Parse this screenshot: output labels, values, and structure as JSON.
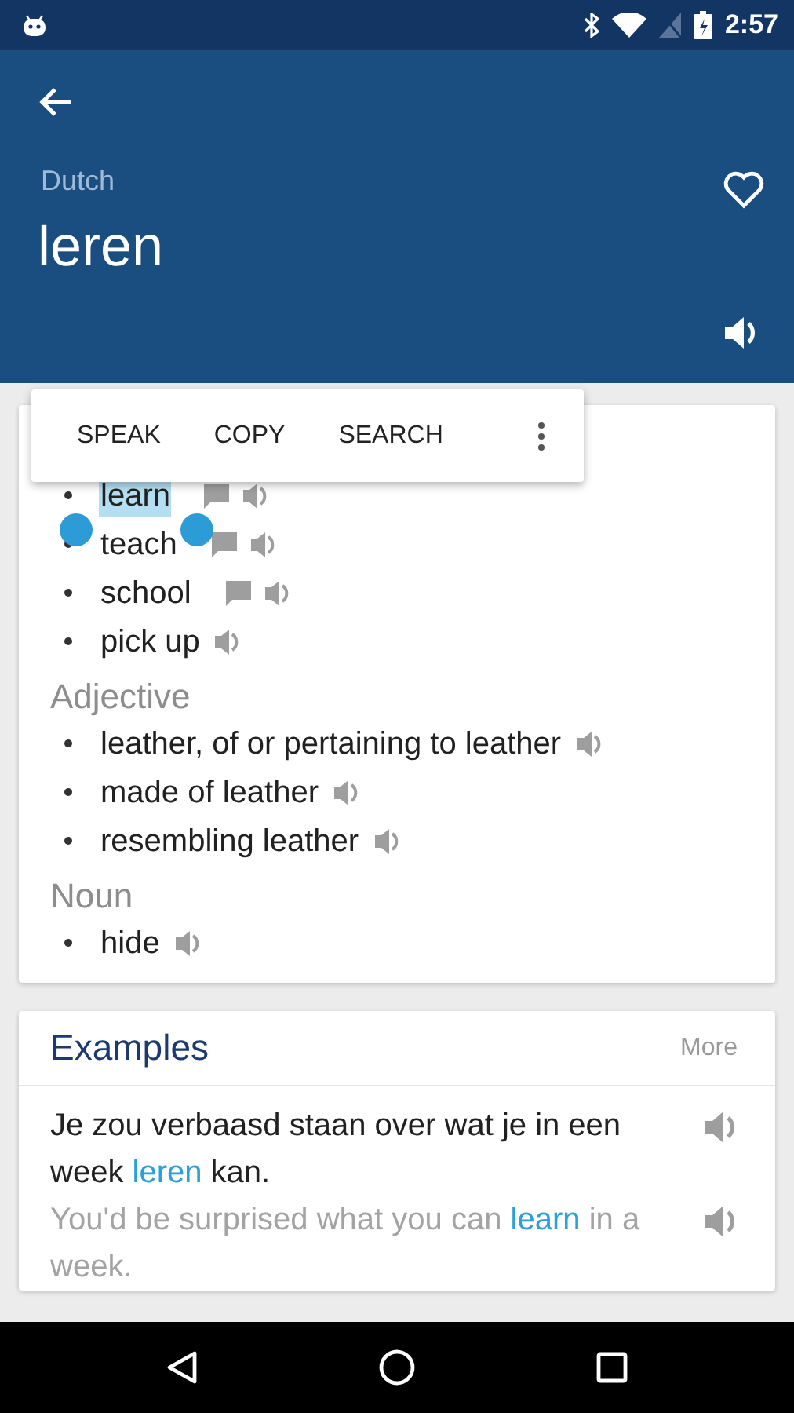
{
  "status_bar": {
    "time": "2:57"
  },
  "app_bar": {
    "language": "Dutch",
    "word": "leren",
    "favorite": false
  },
  "selection_menu": {
    "items": [
      "SPEAK",
      "COPY",
      "SEARCH"
    ]
  },
  "sections": [
    {
      "entries": [
        {
          "text": "learn",
          "selected": true,
          "note": true
        },
        {
          "text": "teach",
          "selected": false,
          "note": true
        },
        {
          "text": "school",
          "selected": false,
          "note": true
        },
        {
          "text": "pick up",
          "selected": false,
          "note": false
        }
      ]
    },
    {
      "heading": "Adjective",
      "entries": [
        {
          "text": "leather, of or pertaining to leather",
          "selected": false,
          "note": false
        },
        {
          "text": "made of leather",
          "selected": false,
          "note": false
        },
        {
          "text": "resembling leather",
          "selected": false,
          "note": false
        }
      ]
    },
    {
      "heading": "Noun",
      "entries": [
        {
          "text": "hide",
          "selected": false,
          "note": false
        }
      ]
    }
  ],
  "examples": {
    "title": "Examples",
    "more": "More",
    "items": [
      {
        "source": [
          {
            "text": "Je zou verbaasd staan over wat je in een week ",
            "highlight": false
          },
          {
            "text": "leren",
            "highlight": true
          },
          {
            "text": " kan.",
            "highlight": false
          }
        ],
        "translation": [
          {
            "text": "You'd be surprised what you can ",
            "highlight": false
          },
          {
            "text": "learn",
            "highlight": true
          },
          {
            "text": " in a week.",
            "highlight": false
          }
        ]
      }
    ]
  }
}
